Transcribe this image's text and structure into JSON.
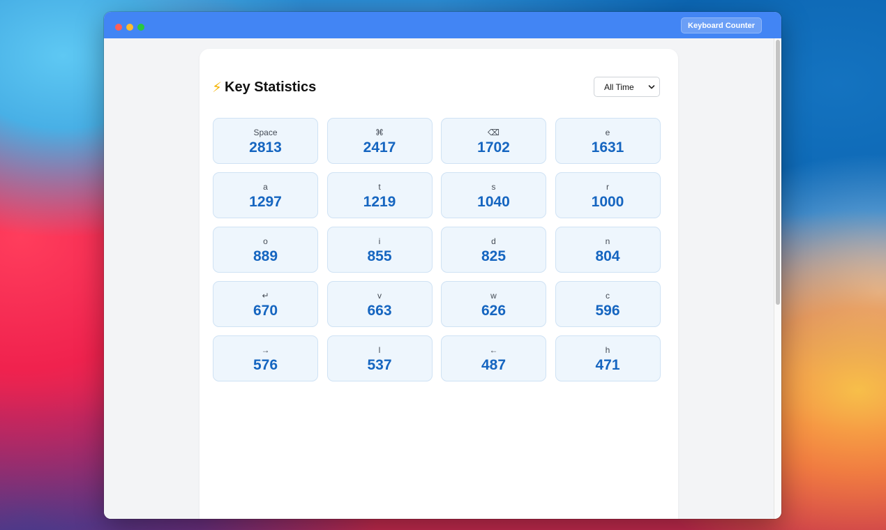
{
  "window": {
    "title_button": "Keyboard Counter"
  },
  "page": {
    "icon": "⚡",
    "title": "Key Statistics",
    "range_select": {
      "selected": "All Time"
    }
  },
  "stats": [
    {
      "key": "Space",
      "count": "2813"
    },
    {
      "key": "⌘",
      "count": "2417"
    },
    {
      "key": "⌫",
      "count": "1702"
    },
    {
      "key": "e",
      "count": "1631"
    },
    {
      "key": "a",
      "count": "1297"
    },
    {
      "key": "t",
      "count": "1219"
    },
    {
      "key": "s",
      "count": "1040"
    },
    {
      "key": "r",
      "count": "1000"
    },
    {
      "key": "o",
      "count": "889"
    },
    {
      "key": "i",
      "count": "855"
    },
    {
      "key": "d",
      "count": "825"
    },
    {
      "key": "n",
      "count": "804"
    },
    {
      "key": "↵",
      "count": "670"
    },
    {
      "key": "v",
      "count": "663"
    },
    {
      "key": "w",
      "count": "626"
    },
    {
      "key": "c",
      "count": "596"
    },
    {
      "key": "→",
      "count": "576"
    },
    {
      "key": "l",
      "count": "537"
    },
    {
      "key": "←",
      "count": "487"
    },
    {
      "key": "h",
      "count": "471"
    }
  ],
  "colors": {
    "titlebar": "#4285f4",
    "accent": "#1565c0",
    "stat_background": "#eef6fd"
  }
}
